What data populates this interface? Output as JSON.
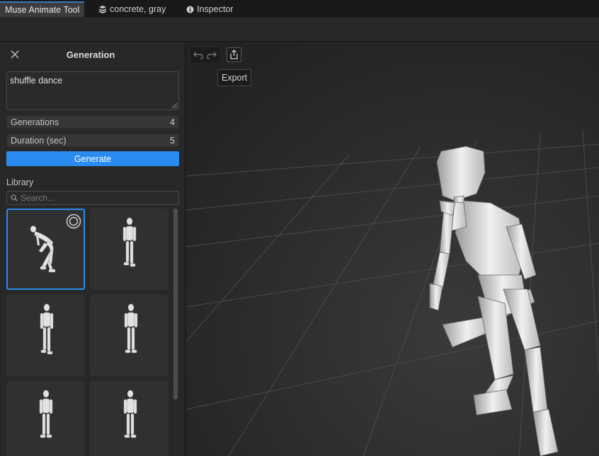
{
  "tabs": [
    {
      "label": "Muse Animate Tool",
      "icon": "none",
      "active": true
    },
    {
      "label": "concrete, gray",
      "icon": "material-icon",
      "active": false
    },
    {
      "label": "Inspector",
      "icon": "info-icon",
      "active": false
    }
  ],
  "panel": {
    "title": "Generation",
    "close_icon": "close-icon",
    "prompt": "shuffle dance",
    "fields": [
      {
        "label": "Generations",
        "value": "4"
      },
      {
        "label": "Duration (sec)",
        "value": "5"
      }
    ],
    "generate_label": "Generate",
    "accent_color": "#2a8cf0"
  },
  "library": {
    "label": "Library",
    "search_placeholder": "Search...",
    "thumbnails": [
      {
        "pose": "crouch",
        "selected": true
      },
      {
        "pose": "stand",
        "selected": false
      },
      {
        "pose": "stand",
        "selected": false
      },
      {
        "pose": "stand",
        "selected": false
      },
      {
        "pose": "stand",
        "selected": false
      },
      {
        "pose": "stand",
        "selected": false
      }
    ]
  },
  "viewport": {
    "undo_icon": "undo-icon",
    "redo_icon": "redo-icon",
    "export_icon": "export-icon",
    "tooltip": "Export"
  }
}
